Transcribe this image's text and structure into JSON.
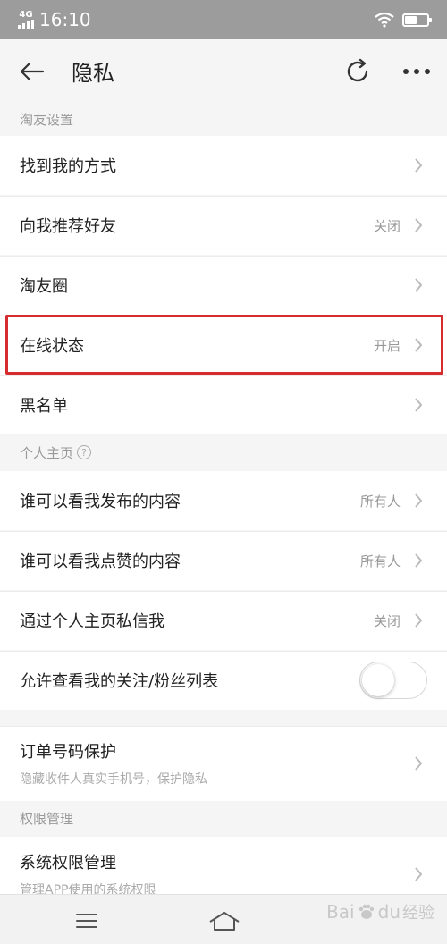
{
  "status_bar": {
    "network": "4G",
    "time": "16:10",
    "battery_level": 0.55
  },
  "nav": {
    "title": "隐私",
    "back_icon": "arrow-left-icon",
    "refresh_icon": "refresh-icon",
    "more_icon": "more-dots-icon"
  },
  "sections": {
    "friends_header": "淘友设置",
    "homepage_header": "个人主页",
    "permissions_header": "权限管理"
  },
  "friends_rows": [
    {
      "label": "找到我的方式",
      "value": ""
    },
    {
      "label": "向我推荐好友",
      "value": "关闭"
    },
    {
      "label": "淘友圈",
      "value": ""
    },
    {
      "label": "在线状态",
      "value": "开启"
    },
    {
      "label": "黑名单",
      "value": ""
    }
  ],
  "homepage_rows": [
    {
      "label": "谁可以看我发布的内容",
      "value": "所有人"
    },
    {
      "label": "谁可以看我点赞的内容",
      "value": "所有人"
    },
    {
      "label": "通过个人主页私信我",
      "value": "关闭"
    },
    {
      "label": "允许查看我的关注/粉丝列表",
      "toggle_on": false
    }
  ],
  "order_protection": {
    "label": "订单号码保护",
    "sub": "隐藏收件人真实手机号，保护隐私"
  },
  "permissions_row": {
    "label": "系统权限管理",
    "sub": "管理APP使用的系统权限"
  },
  "watermark": {
    "brand_a": "Bai",
    "brand_b": "du",
    "suffix": "经验"
  },
  "colors": {
    "highlight": "#d62b2f",
    "status_bar": "#9c9c9c"
  }
}
